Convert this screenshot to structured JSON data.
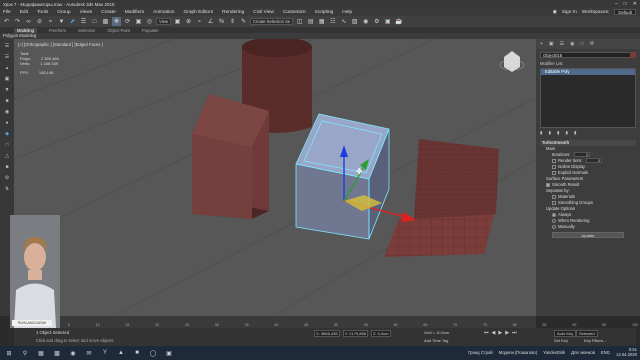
{
  "window": {
    "title": "Урок 7 - Модификаторы.max - Autodesk 3ds Max 2018",
    "controls": [
      "–",
      "□",
      "✕"
    ]
  },
  "menu": {
    "items": [
      "File",
      "Edit",
      "Tools",
      "Group",
      "Views",
      "Create",
      "Modifiers",
      "Animation",
      "Graph Editors",
      "Rendering",
      "Civil View",
      "Customize",
      "Scripting",
      "Help"
    ],
    "sign_in": "Sign In",
    "workspaces_label": "Workspaces:",
    "workspace_value": "Default"
  },
  "toolbar": {
    "view_select": "View",
    "selection_set": "Create Selection Se"
  },
  "ribbon": {
    "tabs": [
      "Modeling",
      "Freeform",
      "Selection",
      "Object Paint",
      "Populate"
    ],
    "active_tab": "Modeling",
    "subtitle": "Polygon Modeling"
  },
  "viewport": {
    "label": "[+] [Orthographic ] [Standard ] [Edged Faces ]",
    "stats": {
      "total_label": "Total",
      "polys_label": "Polys:",
      "polys_value": "2 355 468",
      "verts_label": "Verts:",
      "verts_value": "1 168 339",
      "fps_label": "FPS:",
      "fps_value": "145,146"
    }
  },
  "command_panel": {
    "object_name": "Object018",
    "modifier_list": "Modifier List",
    "stack_item": "Editable Poly",
    "turbosmooth": {
      "header": "TurboSmooth",
      "main_label": "Main",
      "iterations_label": "Iterations:",
      "iterations_value": "0",
      "render_iters_label": "Render Iters:",
      "render_iters_value": "0",
      "isoline_label": "Isoline Display",
      "explicit_label": "Explicit Normals",
      "surface_label": "Surface Parameters",
      "smooth_result_label": "Smooth Result",
      "separate_label": "Separate by:",
      "materials_label": "Materials",
      "smoothing_groups_label": "Smoothing Groups",
      "update_options_label": "Update Options",
      "always_label": "Always",
      "when_rendering_label": "When Rendering",
      "manually_label": "Manually",
      "update_button": "Update"
    },
    "swatch_color": "#7a3a36"
  },
  "timeline": {
    "slider_label": "0 / 100",
    "ticks": [
      "0",
      "5",
      "10",
      "15",
      "20",
      "25",
      "30",
      "35",
      "40",
      "45",
      "50",
      "55",
      "60",
      "65",
      "70",
      "75",
      "80",
      "85",
      "90",
      "95",
      "100"
    ]
  },
  "status": {
    "selection": "1 Object Selected",
    "prompt": "Click and drag to select and move objects",
    "x": "X: 3665,435",
    "y": "Y: 2179,856",
    "z": "Z: 0,0cm",
    "grid": "Grid = 10,0cm",
    "add_time_tag": "Add Time Tag",
    "auto_key": "Auto Key",
    "selected": "Selected",
    "set_key": "Set Key",
    "key_filters": "Key Filters..."
  },
  "webcam": {
    "banner": "RUSLANCGASW"
  },
  "taskbar": {
    "items": [
      "Гранд Строй",
      "Модели (Пошагово)",
      "YandexDisk",
      "Для значков"
    ],
    "lang": "ENG",
    "time": "5:51",
    "date": "14.04.2020"
  }
}
